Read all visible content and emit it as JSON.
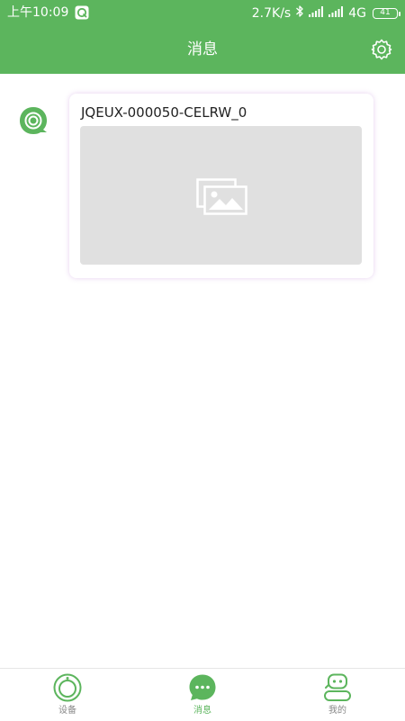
{
  "status_bar": {
    "time": "上午10:09",
    "network_speed": "2.7K/s",
    "network_type": "4G",
    "battery_level": "41"
  },
  "header": {
    "title": "消息",
    "settings_icon": "gear-icon"
  },
  "colors": {
    "primary": "#5cb55d",
    "placeholder": "#e0e0e0",
    "tab_inactive": "#888888"
  },
  "messages": [
    {
      "avatar_icon": "camera-icon",
      "title": "JQEUX-000050-CELRW_0",
      "image_icon": "image-placeholder-icon"
    }
  ],
  "tab_bar": {
    "tabs": [
      {
        "label": "设备",
        "icon": "device-icon",
        "active": false
      },
      {
        "label": "消息",
        "icon": "message-icon",
        "active": true
      },
      {
        "label": "我的",
        "icon": "profile-icon",
        "active": false
      }
    ]
  }
}
